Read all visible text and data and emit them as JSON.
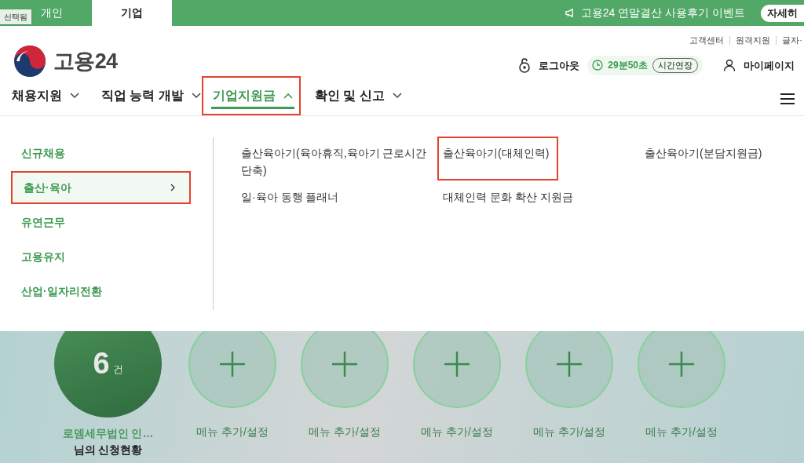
{
  "top_bar": {
    "tabs": [
      {
        "label": "개인",
        "selected": false
      },
      {
        "label": "기업",
        "selected": true
      }
    ],
    "tooltip": "선택됨",
    "notice": "고용24 연말결산 사용후기 이벤트",
    "notice_button": "자세히"
  },
  "utility_links": [
    "고객센터",
    "원격지원",
    "글자·"
  ],
  "logo": {
    "text": "고용24"
  },
  "session": {
    "logout": "로그아웃",
    "timer": "29분50초",
    "extend": "시간연장",
    "mypage": "마이페이지"
  },
  "nav": [
    {
      "label": "채용지원",
      "expanded": false,
      "highlighted": false
    },
    {
      "label": "직업 능력 개발",
      "expanded": false,
      "highlighted": false
    },
    {
      "label": "기업지원금",
      "expanded": true,
      "highlighted": true
    },
    {
      "label": "확인 및 신고",
      "expanded": false,
      "highlighted": false
    }
  ],
  "menu": {
    "categories": [
      {
        "label": "신규채용",
        "selected": false,
        "highlighted": false
      },
      {
        "label": "출산·육아",
        "selected": true,
        "highlighted": true
      },
      {
        "label": "유연근무",
        "selected": false,
        "highlighted": false
      },
      {
        "label": "고용유지",
        "selected": false,
        "highlighted": false
      },
      {
        "label": "산업·일자리전환",
        "selected": false,
        "highlighted": false
      }
    ],
    "items": [
      {
        "label": "출산육아기(육아휴직,육아기 근로시간단축)",
        "highlighted": false
      },
      {
        "label": "출산육아기(대체인력)",
        "highlighted": true
      },
      {
        "label": "출산육아기(분담지원금)",
        "highlighted": false
      },
      {
        "label": "일·육아 동행 플래너",
        "highlighted": false
      },
      {
        "label": "대체인력 문화 확산 지원금",
        "highlighted": false
      }
    ]
  },
  "dashboard": {
    "status": {
      "count": "6",
      "unit": "건",
      "name": "로뎀세무법인 인…",
      "caption": "님의 신청현황"
    },
    "slots": [
      {
        "label": "메뉴 추가/설정"
      },
      {
        "label": "메뉴 추가/설정"
      },
      {
        "label": "메뉴 추가/설정"
      },
      {
        "label": "메뉴 추가/설정"
      },
      {
        "label": "메뉴 추가/설정"
      }
    ]
  }
}
